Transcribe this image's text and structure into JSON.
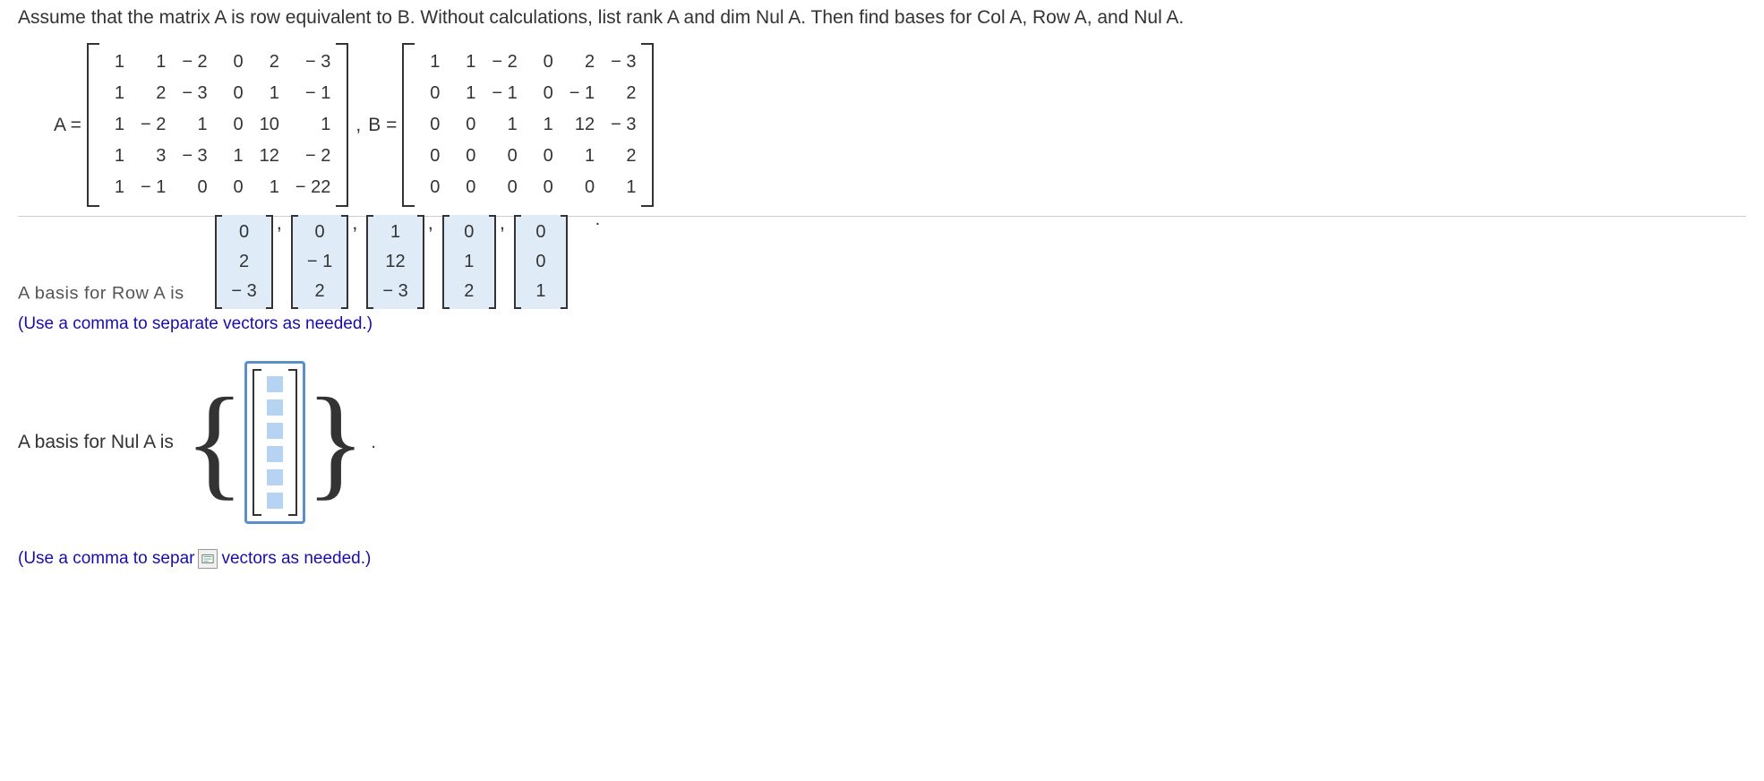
{
  "question": "Assume that the matrix A is row equivalent to B. Without calculations, list rank A and dim Nul A. Then find bases for Col A, Row A, and Nul A.",
  "labelA": "A =",
  "labelB": "B =",
  "matrixA": [
    [
      "1",
      "1",
      "− 2",
      "0",
      "2",
      "− 3"
    ],
    [
      "1",
      "2",
      "− 3",
      "0",
      "1",
      "− 1"
    ],
    [
      "1",
      "− 2",
      "1",
      "0",
      "10",
      "1"
    ],
    [
      "1",
      "3",
      "− 3",
      "1",
      "12",
      "− 2"
    ],
    [
      "1",
      "− 1",
      "0",
      "0",
      "1",
      "− 22"
    ]
  ],
  "matrixB": [
    [
      "1",
      "1",
      "− 2",
      "0",
      "2",
      "− 3"
    ],
    [
      "0",
      "1",
      "− 1",
      "0",
      "− 1",
      "2"
    ],
    [
      "0",
      "0",
      "1",
      "1",
      "12",
      "− 3"
    ],
    [
      "0",
      "0",
      "0",
      "0",
      "1",
      "2"
    ],
    [
      "0",
      "0",
      "0",
      "0",
      "0",
      "1"
    ]
  ],
  "rowA_cutoff_label": "A basis for Row A is",
  "rowA_vectors": [
    [
      "0",
      "2",
      "− 3"
    ],
    [
      "0",
      "− 1",
      "2"
    ],
    [
      "1",
      "12",
      "− 3"
    ],
    [
      "0",
      "1",
      "2"
    ],
    [
      "0",
      "0",
      "1"
    ]
  ],
  "help1": "(Use a comma to separate vectors as needed.)",
  "nulA_label": "A basis for Nul A is",
  "nul_cell_count": 6,
  "help2_pre": "(Use a comma to separ",
  "help2_post": "vectors as needed.)",
  "comma": ","
}
